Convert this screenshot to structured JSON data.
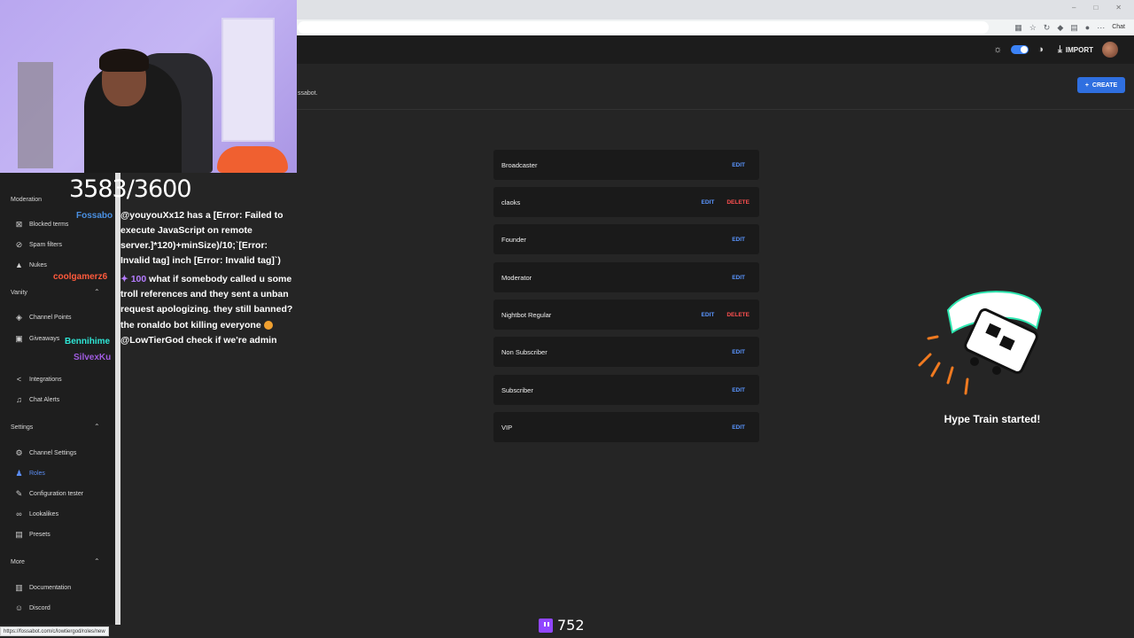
{
  "header": {
    "import_label": "IMPORT",
    "subtext": "ssabot.",
    "create_label": "CREATE",
    "browser_chat": "Chat"
  },
  "counter": "3583/3600",
  "sidebar": {
    "sections": {
      "moderation": "Moderation",
      "vanity": "Vanity",
      "settings": "Settings",
      "more": "More"
    },
    "items": [
      {
        "label": "Blocked terms",
        "icon": "block-icon"
      },
      {
        "label": "Spam filters",
        "icon": "filter-icon"
      },
      {
        "label": "Nukes",
        "icon": "warning-icon"
      },
      {
        "label": "Channel Points",
        "icon": "points-icon"
      },
      {
        "label": "Giveaways",
        "icon": "gift-icon"
      },
      {
        "label": "Integrations",
        "icon": "share-icon"
      },
      {
        "label": "Chat Alerts",
        "icon": "bell-icon"
      },
      {
        "label": "Channel Settings",
        "icon": "gear-icon"
      },
      {
        "label": "Roles",
        "icon": "users-icon"
      },
      {
        "label": "Configuration tester",
        "icon": "wrench-icon"
      },
      {
        "label": "Lookalikes",
        "icon": "lookalike-icon"
      },
      {
        "label": "Presets",
        "icon": "presets-icon"
      },
      {
        "label": "Documentation",
        "icon": "book-icon"
      },
      {
        "label": "Discord",
        "icon": "discord-icon"
      }
    ]
  },
  "chat": {
    "names": {
      "fossabot": "Fossabo",
      "coolgamer": "coolgamerz6",
      "bennihime": "Bennihime",
      "silvex": "SilvexKu"
    },
    "messages": [
      "@youyouXx12 has a [Error: Failed to execute JavaScript on remote server.]*120)+minSize)/10;`[Error: Invalid tag] inch [Error: Invalid tag]`)",
      "what if somebody called u some troll references and they sent a unban request apologizing. they still banned?",
      "the ronaldo bot killing everyone",
      "@LowTierGod check if we're admin"
    ],
    "bits_amount": "100"
  },
  "roles": [
    {
      "name": "Broadcaster",
      "edit": "EDIT",
      "delete": ""
    },
    {
      "name": "claoks",
      "edit": "EDIT",
      "delete": "DELETE"
    },
    {
      "name": "Founder",
      "edit": "EDIT",
      "delete": ""
    },
    {
      "name": "Moderator",
      "edit": "EDIT",
      "delete": ""
    },
    {
      "name": "Nightbot Regular",
      "edit": "EDIT",
      "delete": "DELETE"
    },
    {
      "name": "Non Subscriber",
      "edit": "EDIT",
      "delete": ""
    },
    {
      "name": "Subscriber",
      "edit": "EDIT",
      "delete": ""
    },
    {
      "name": "VIP",
      "edit": "EDIT",
      "delete": ""
    }
  ],
  "hype_train": {
    "label": "Hype Train started!"
  },
  "status_url": "https://fossabot.com/c/lowtiergod/roles/new",
  "viewer_count": "752",
  "colors": {
    "accent": "#2f6fe0",
    "edit": "#5a95ff",
    "delete": "#ff5050",
    "twitch": "#9146ff"
  }
}
